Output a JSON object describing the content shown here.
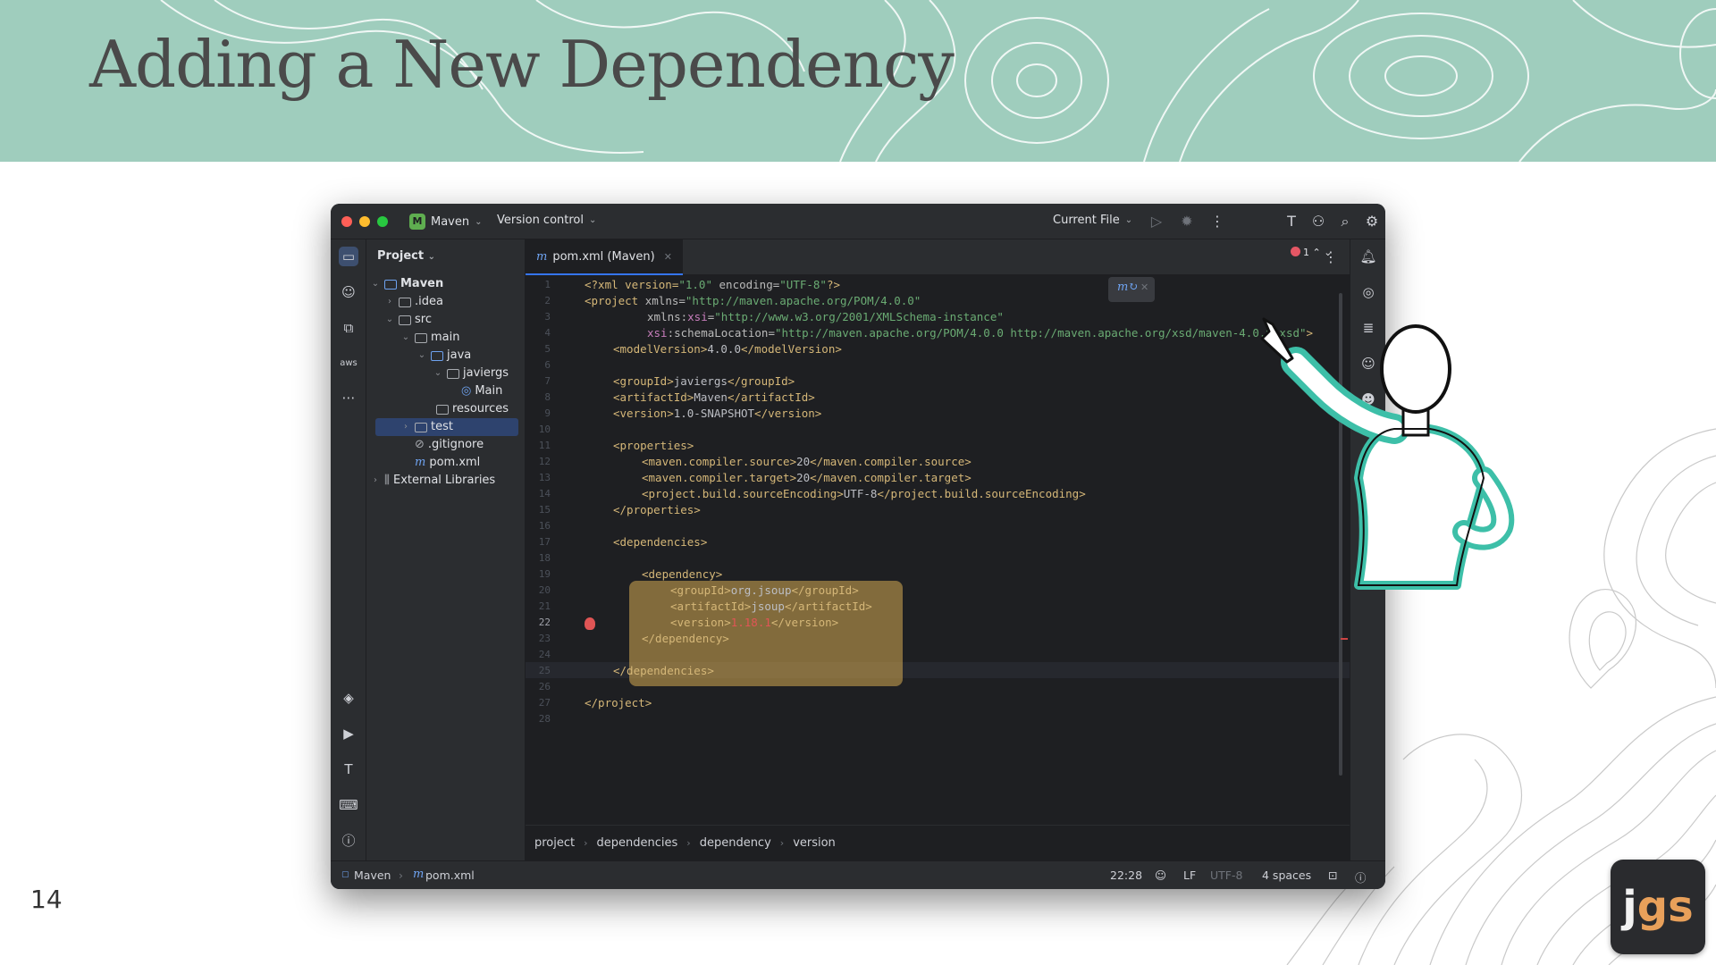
{
  "slide": {
    "title": "Adding a New Dependency",
    "number": "14",
    "logo": {
      "j": "j",
      "gs": "gs"
    },
    "colors": {
      "banner": "#9fcdbd",
      "title": "#4a4a4a"
    }
  },
  "titlebar": {
    "project_badge": "M",
    "project": "Maven",
    "vcs": "Version control",
    "run_config": "Current File"
  },
  "project_panel": {
    "header": "Project",
    "tree": [
      {
        "label": "Maven",
        "bold": true
      },
      {
        "label": ".idea"
      },
      {
        "label": "src"
      },
      {
        "label": "main"
      },
      {
        "label": "java"
      },
      {
        "label": "javiergs"
      },
      {
        "label": "Main",
        "selected": true
      },
      {
        "label": "resources"
      },
      {
        "label": "test"
      },
      {
        "label": ".gitignore"
      },
      {
        "label": "pom.xml"
      },
      {
        "label": "External Libraries"
      }
    ]
  },
  "editor": {
    "tab_label": "pom.xml (Maven)",
    "error_count": "1",
    "current_line": 22,
    "lines": [
      "1",
      "2",
      "3",
      "4",
      "5",
      "6",
      "7",
      "8",
      "9",
      "10",
      "11",
      "12",
      "13",
      "14",
      "15",
      "16",
      "17",
      "18",
      "19",
      "20",
      "21",
      "22",
      "23",
      "24",
      "25",
      "26",
      "27",
      "28"
    ],
    "code": {
      "l1_a": "<?xml version=",
      "l1_b": "\"1.0\"",
      "l1_c": " encoding=",
      "l1_d": "\"UTF-8\"",
      "l1_e": "?>",
      "l2_a": "<project",
      "l2_b": " xmlns=",
      "l2_c": "\"http://maven.apache.org/POM/4.0.0\"",
      "l3_a": "xmlns:",
      "l3_b": "xsi",
      "l3_c": "=",
      "l3_d": "\"http://www.w3.org/2001/XMLSchema-instance\"",
      "l4_a": "xsi",
      "l4_b": ":schemaLocation=",
      "l4_c": "\"http://maven.apache.org/POM/4.0.0 http://maven.apache.org/xsd/maven-4.0.0.xsd\"",
      "l4_d": ">",
      "l5_a": "<modelVersion>",
      "l5_b": "4.0.0",
      "l5_c": "</modelVersion>",
      "l7_a": "<groupId>",
      "l7_b": "javiergs",
      "l7_c": "</groupId>",
      "l8_a": "<artifactId>",
      "l8_b": "Maven",
      "l8_c": "</artifactId>",
      "l9_a": "<version>",
      "l9_b": "1.0-SNAPSHOT",
      "l9_c": "</version>",
      "l11": "<properties>",
      "l12_a": "<maven.compiler.source>",
      "l12_b": "20",
      "l12_c": "</maven.compiler.source>",
      "l13_a": "<maven.compiler.target>",
      "l13_b": "20",
      "l13_c": "</maven.compiler.target>",
      "l14_a": "<project.build.sourceEncoding>",
      "l14_b": "UTF-8",
      "l14_c": "</project.build.sourceEncoding>",
      "l15": "</properties>",
      "l17": "<dependencies>",
      "l19": "<dependency>",
      "l20_a": "<groupId>",
      "l20_b": "org.jsoup",
      "l20_c": "</groupId>",
      "l21_a": "<artifactId>",
      "l21_b": "jsoup",
      "l21_c": "</artifactId>",
      "l22_a": "<version>",
      "l22_b": "1.18.1",
      "l22_c": "</version>",
      "l23": "</dependency>",
      "l25": "</dependencies>",
      "l27": "</project>"
    }
  },
  "breadcrumbs": [
    "project",
    "dependencies",
    "dependency",
    "version"
  ],
  "statusbar": {
    "project": "Maven",
    "file": "pom.xml",
    "position": "22:28",
    "line_sep": "LF",
    "encoding": "UTF-8",
    "indent": "4 spaces"
  }
}
